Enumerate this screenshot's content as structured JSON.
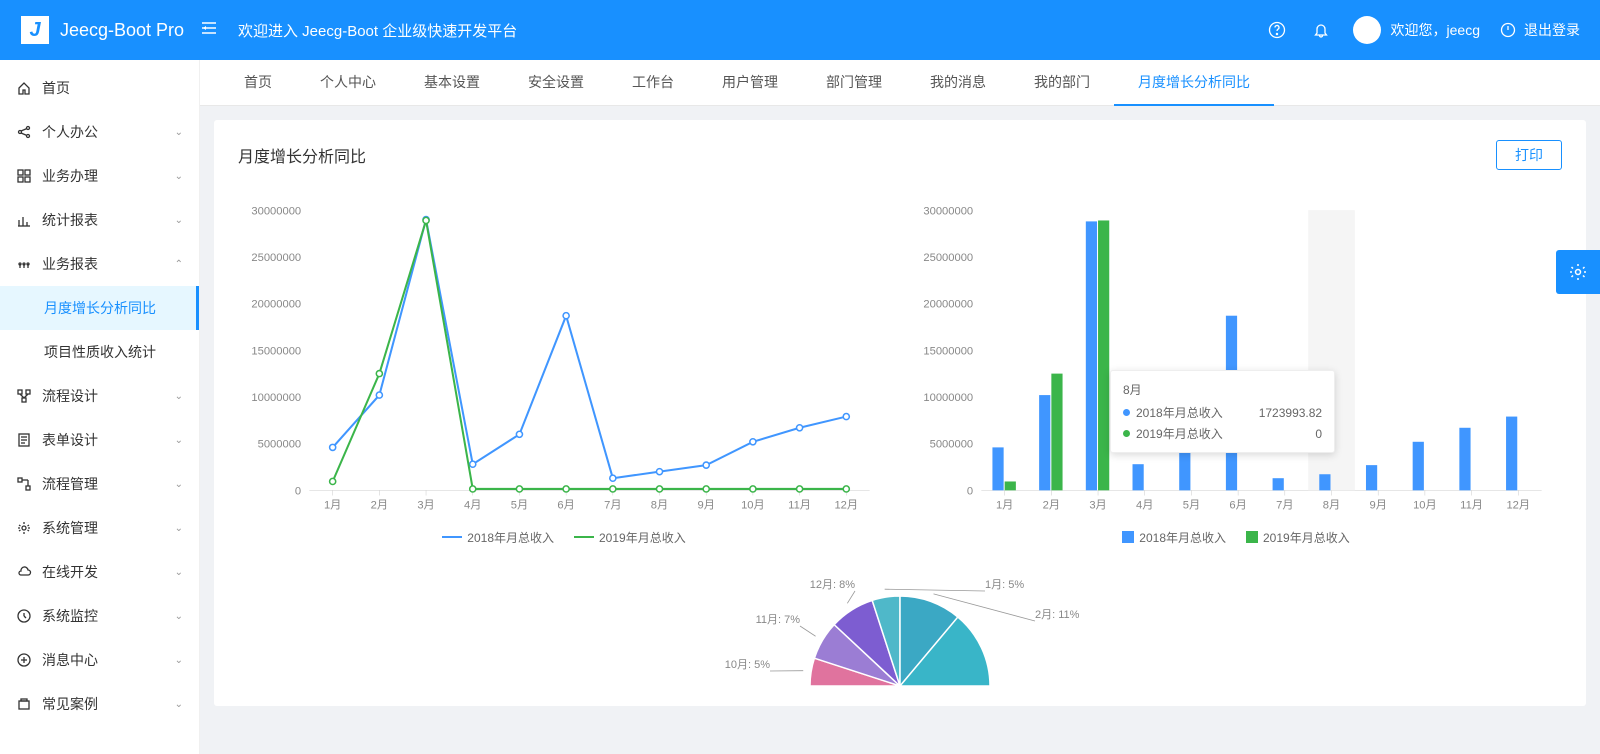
{
  "app": {
    "name": "Jeecg-Boot Pro",
    "welcome": "欢迎进入 Jeecg-Boot 企业级快速开发平台",
    "user_greeting": "欢迎您，jeecg",
    "logout": "退出登录"
  },
  "sidebar": {
    "items": [
      {
        "icon": "home",
        "label": "首页",
        "expandable": false
      },
      {
        "icon": "share",
        "label": "个人办公",
        "expandable": true,
        "open": false
      },
      {
        "icon": "grid",
        "label": "业务办理",
        "expandable": true,
        "open": false
      },
      {
        "icon": "chart",
        "label": "统计报表",
        "expandable": true,
        "open": false
      },
      {
        "icon": "report",
        "label": "业务报表",
        "expandable": true,
        "open": true,
        "children": [
          {
            "label": "月度增长分析同比",
            "active": true
          },
          {
            "label": "项目性质收入统计",
            "active": false
          }
        ]
      },
      {
        "icon": "flow",
        "label": "流程设计",
        "expandable": true,
        "open": false
      },
      {
        "icon": "form",
        "label": "表单设计",
        "expandable": true,
        "open": false
      },
      {
        "icon": "process",
        "label": "流程管理",
        "expandable": true,
        "open": false
      },
      {
        "icon": "gear",
        "label": "系统管理",
        "expandable": true,
        "open": false
      },
      {
        "icon": "cloud",
        "label": "在线开发",
        "expandable": true,
        "open": false
      },
      {
        "icon": "monitor",
        "label": "系统监控",
        "expandable": true,
        "open": false
      },
      {
        "icon": "message",
        "label": "消息中心",
        "expandable": true,
        "open": false
      },
      {
        "icon": "case",
        "label": "常见案例",
        "expandable": true,
        "open": false
      }
    ]
  },
  "tabs": [
    {
      "label": "首页",
      "active": false
    },
    {
      "label": "个人中心",
      "active": false
    },
    {
      "label": "基本设置",
      "active": false
    },
    {
      "label": "安全设置",
      "active": false
    },
    {
      "label": "工作台",
      "active": false
    },
    {
      "label": "用户管理",
      "active": false
    },
    {
      "label": "部门管理",
      "active": false
    },
    {
      "label": "我的消息",
      "active": false
    },
    {
      "label": "我的部门",
      "active": false
    },
    {
      "label": "月度增长分析同比",
      "active": true
    }
  ],
  "panel": {
    "title": "月度增长分析同比",
    "print": "打印"
  },
  "chart_data": [
    {
      "type": "line",
      "categories": [
        "1月",
        "2月",
        "3月",
        "4月",
        "5月",
        "6月",
        "7月",
        "8月",
        "9月",
        "10月",
        "11月",
        "12月"
      ],
      "series": [
        {
          "name": "2018年月总收入",
          "color": "#4096ff",
          "values": [
            4600000,
            10200000,
            29000000,
            2800000,
            6000000,
            18700000,
            1300000,
            2000000,
            2700000,
            5200000,
            6700000,
            7900000
          ]
        },
        {
          "name": "2019年月总收入",
          "color": "#3bb54a",
          "values": [
            950000,
            12500000,
            28900000,
            150000,
            150000,
            150000,
            150000,
            150000,
            150000,
            150000,
            150000,
            150000
          ]
        }
      ],
      "ylim": [
        0,
        30000000
      ],
      "yticks": [
        0,
        5000000,
        10000000,
        15000000,
        20000000,
        25000000,
        30000000
      ]
    },
    {
      "type": "bar",
      "categories": [
        "1月",
        "2月",
        "3月",
        "4月",
        "5月",
        "6月",
        "7月",
        "8月",
        "9月",
        "10月",
        "11月",
        "12月"
      ],
      "series": [
        {
          "name": "2018年月总收入",
          "color": "#4096ff",
          "values": [
            4600000,
            10200000,
            28800000,
            2800000,
            6000000,
            18700000,
            1300000,
            1723993.82,
            2700000,
            5200000,
            6700000,
            7900000
          ]
        },
        {
          "name": "2019年月总收入",
          "color": "#3bb54a",
          "values": [
            950000,
            12500000,
            28900000,
            0,
            0,
            0,
            0,
            0,
            0,
            0,
            0,
            0
          ]
        }
      ],
      "ylim": [
        0,
        30000000
      ],
      "yticks": [
        0,
        5000000,
        10000000,
        15000000,
        20000000,
        25000000,
        30000000
      ],
      "tooltip": {
        "category": "8月",
        "rows": [
          {
            "color": "#4096ff",
            "label": "2018年月总收入",
            "value": "1723993.82"
          },
          {
            "color": "#3bb54a",
            "label": "2019年月总收入",
            "value": "0"
          }
        ]
      }
    },
    {
      "type": "pie",
      "slices": [
        {
          "label": "1月: 5%",
          "value": 5,
          "color": "#4fb8c9"
        },
        {
          "label": "2月: 11%",
          "value": 11,
          "color": "#3ba8c4"
        },
        {
          "label": "10月: 5%",
          "value": 5,
          "color": "#e0739e"
        },
        {
          "label": "11月: 7%",
          "value": 7,
          "color": "#9b7dd4"
        },
        {
          "label": "12月: 8%",
          "value": 8,
          "color": "#7d5dd1"
        }
      ]
    }
  ],
  "colors": {
    "primary": "#1890ff",
    "series1": "#4096ff",
    "series2": "#3bb54a"
  }
}
